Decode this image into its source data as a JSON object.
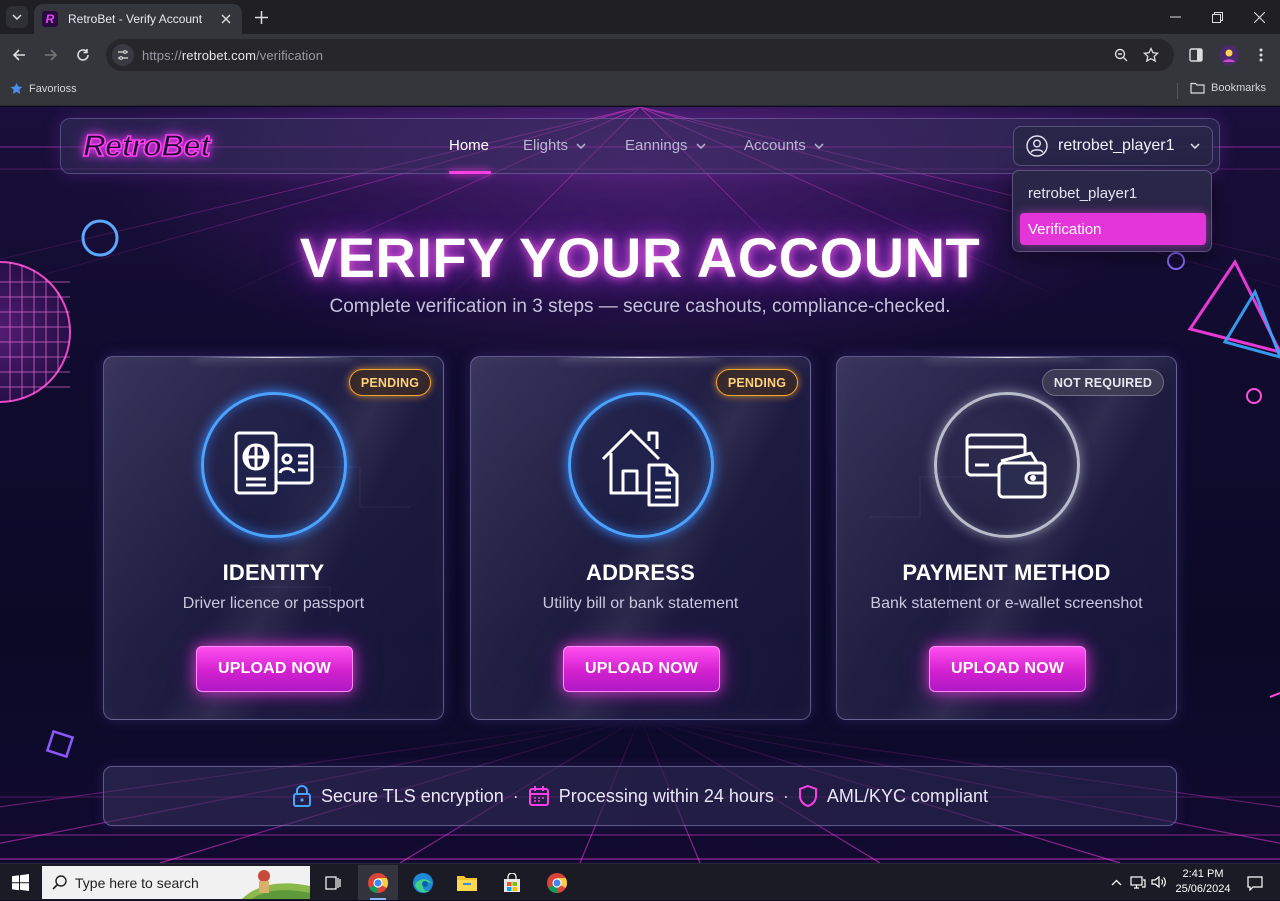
{
  "browser": {
    "tab_title": "RetroBet - Verify Account",
    "favicon_letter": "R",
    "url_scheme": "https://",
    "url_host": "retrobet.com",
    "url_path": "/verification",
    "bookmarks": {
      "left": "Favoriоss",
      "right": "Bookmarks"
    }
  },
  "site": {
    "logo": "RetroBet",
    "nav": [
      {
        "label": "Home",
        "active": true
      },
      {
        "label": "Elights",
        "dropdown": true
      },
      {
        "label": "Eannings",
        "dropdown": true
      },
      {
        "label": "Accounts",
        "dropdown": true
      }
    ],
    "user": {
      "username": "retrobet_player1"
    },
    "dropdown": {
      "items": [
        "retrobet_player1",
        "Verification"
      ],
      "selected": "Verification"
    }
  },
  "hero": {
    "title": "VERIFY YOUR ACCOUNT",
    "subtitle": "Complete verification in 3 steps — secure cashouts, compliance-checked."
  },
  "cards": [
    {
      "title": "IDENTITY",
      "subtitle": "Driver licence or passport",
      "badge": "PENDING",
      "status": "pending",
      "button": "UPLOAD NOW",
      "icon": "passport-id-icon"
    },
    {
      "title": "ADDRESS",
      "subtitle": "Utility bill or bank statement",
      "badge": "PENDING",
      "status": "pending",
      "button": "UPLOAD NOW",
      "icon": "house-document-icon"
    },
    {
      "title": "PAYMENT METHOD",
      "subtitle": "Bank statement or e-wallet screenshot",
      "badge": "NOT REQUIRED",
      "status": "not-required",
      "button": "UPLOAD NOW",
      "icon": "card-wallet-icon"
    }
  ],
  "footer": {
    "items": [
      "Secure TLS encryption",
      "Processing within 24 hours",
      "AML/KYC compliant"
    ],
    "separator": "·"
  },
  "taskbar": {
    "search_placeholder": "Type here to search",
    "time": "2:41 PM",
    "date": "25/06/2024"
  },
  "colors": {
    "accent": "#e436d8",
    "neon_blue": "#4aa3ff",
    "pending": "#ffaa2a",
    "background": "#0c0a22"
  }
}
